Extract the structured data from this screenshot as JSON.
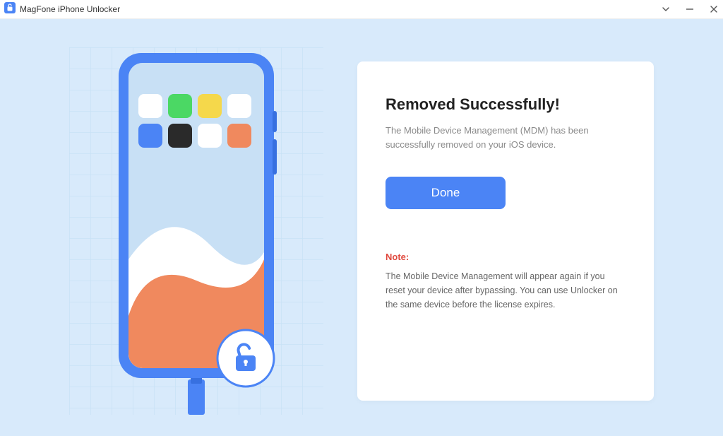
{
  "titlebar": {
    "title": "MagFone iPhone Unlocker"
  },
  "panel": {
    "heading": "Removed Successfully!",
    "subtitle": "The Mobile Device Management (MDM) has been successfully removed on your iOS device.",
    "done_label": "Done",
    "note_label": "Note:",
    "note_text": "The Mobile Device Management will appear again if you reset your device after bypassing. You can use Unlocker on the same device before the license expires."
  }
}
